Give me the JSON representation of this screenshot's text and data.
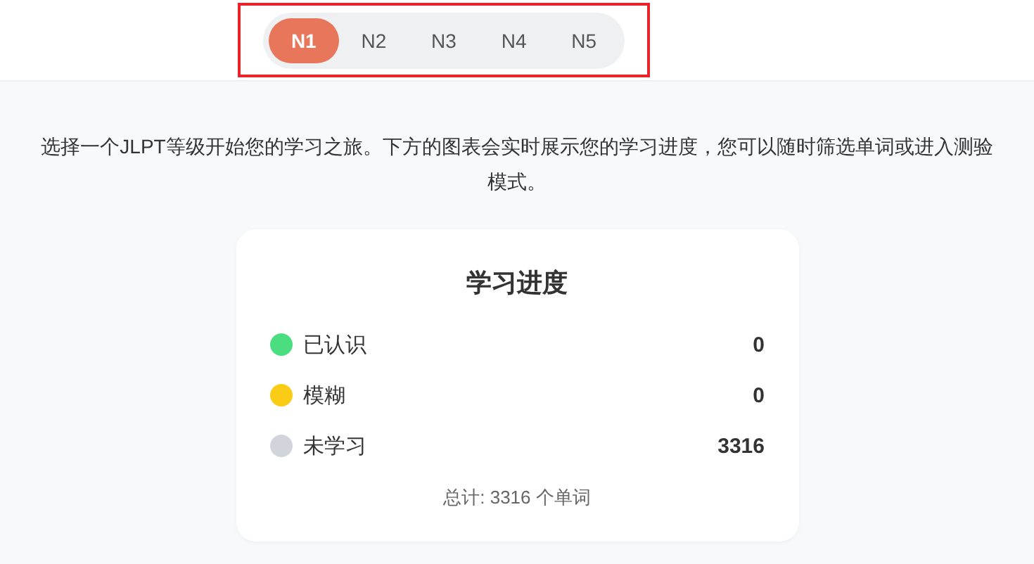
{
  "level_tabs": [
    {
      "label": "N1",
      "selected": true
    },
    {
      "label": "N2",
      "selected": false
    },
    {
      "label": "N3",
      "selected": false
    },
    {
      "label": "N4",
      "selected": false
    },
    {
      "label": "N5",
      "selected": false
    }
  ],
  "intro": "选择一个JLPT等级开始您的学习之旅。下方的图表会实时展示您的学习进度，您可以随时筛选单词或进入测验模式。",
  "progress_card": {
    "title": "学习进度",
    "legend": [
      {
        "label": "已认识",
        "value": "0",
        "color": "#4ade80"
      },
      {
        "label": "模糊",
        "value": "0",
        "color": "#facc15"
      },
      {
        "label": "未学习",
        "value": "3316",
        "color": "#d1d5db"
      }
    ],
    "total": "总计: 3316 个单词"
  }
}
